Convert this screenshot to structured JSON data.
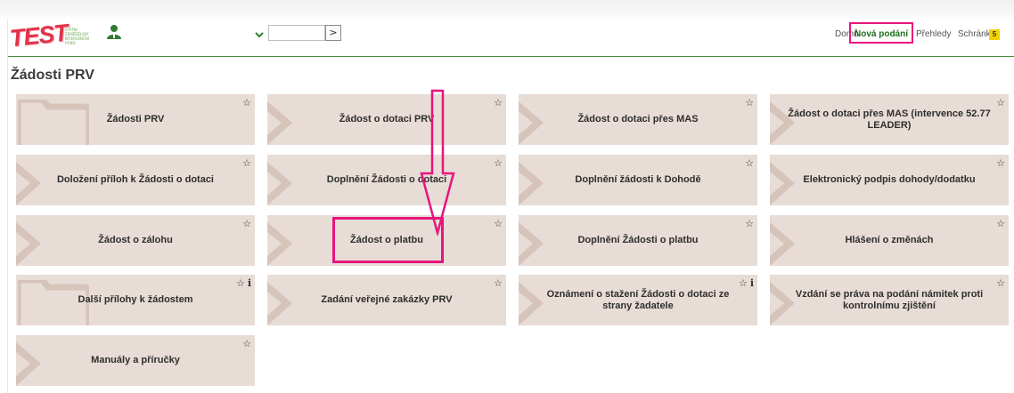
{
  "header": {
    "logo_text": "TEST",
    "logo_subtext": "STÁTNÍ ZEMĚDĚLSKÝ INTERVENČNÍ FOND",
    "user_icon": "user-icon",
    "dropdown_icon": "chevron-down-icon",
    "search_value": "",
    "go_label": ">",
    "nav": {
      "home": "Domů",
      "new": "Nová podání",
      "overview": "Přehledy",
      "inbox": "Schránka",
      "inbox_count": "5"
    }
  },
  "page_title": "Žádosti PRV",
  "tiles": [
    {
      "label": "Žádosti PRV",
      "icons": [
        "star-icon"
      ],
      "decor": "folder"
    },
    {
      "label": "Žádost o dotaci PRV",
      "icons": [
        "star-icon"
      ],
      "decor": "chevron"
    },
    {
      "label": "Žádost o dotaci přes MAS",
      "icons": [
        "star-icon"
      ],
      "decor": "chevron"
    },
    {
      "label": "Žádost o dotaci přes MAS (intervence 52.77 LEADER)",
      "icons": [
        "star-icon"
      ],
      "decor": "chevron"
    },
    {
      "label": "Doložení příloh k Žádosti o dotaci",
      "icons": [
        "star-icon"
      ],
      "decor": "chevron"
    },
    {
      "label": "Doplnění Žádosti o dotaci",
      "icons": [
        "star-icon"
      ],
      "decor": "chevron"
    },
    {
      "label": "Doplnění žádosti k Dohodě",
      "icons": [
        "star-icon"
      ],
      "decor": "chevron"
    },
    {
      "label": "Elektronický podpis dohody/dodatku",
      "icons": [
        "star-icon"
      ],
      "decor": "chevron"
    },
    {
      "label": "Žádost o zálohu",
      "icons": [
        "star-icon"
      ],
      "decor": "chevron"
    },
    {
      "label": "Žádost o platbu",
      "icons": [
        "star-icon"
      ],
      "decor": "chevron"
    },
    {
      "label": "Doplnění Žádosti o platbu",
      "icons": [
        "star-icon"
      ],
      "decor": "chevron"
    },
    {
      "label": "Hlášení o změnách",
      "icons": [
        "star-icon"
      ],
      "decor": "chevron"
    },
    {
      "label": "Další přílohy k žádostem",
      "icons": [
        "star-icon",
        "info-icon"
      ],
      "decor": "folder"
    },
    {
      "label": "Zadání veřejné zakázky PRV",
      "icons": [
        "star-icon"
      ],
      "decor": "chevron"
    },
    {
      "label": "Oznámení o stažení Žádosti o dotaci ze strany žadatele",
      "icons": [
        "star-icon",
        "info-icon"
      ],
      "decor": "chevron"
    },
    {
      "label": "Vzdání se práva na podání námitek proti kontrolnímu zjištění",
      "icons": [
        "star-icon"
      ],
      "decor": "chevron"
    },
    {
      "label": "Manuály a příručky",
      "icons": [
        "star-icon"
      ],
      "decor": "chevron"
    }
  ],
  "glyphs": {
    "star": "☆",
    "info": "i"
  },
  "colors": {
    "tile_bg": "#e8dcd6",
    "tile_decor": "#d6c4ba",
    "highlight": "#e8157c",
    "brand_green": "#1e6e1e",
    "badge": "#f5d100"
  }
}
